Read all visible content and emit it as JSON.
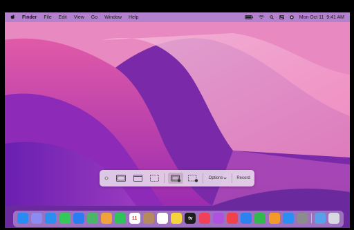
{
  "menubar": {
    "apple": "",
    "app_name": "Finder",
    "items": [
      "File",
      "Edit",
      "View",
      "Go",
      "Window",
      "Help"
    ],
    "datetime": "Mon Oct 11  9:41 AM"
  },
  "screenshot_toolbar": {
    "options_label": "Options",
    "record_label": "Record"
  },
  "dock": {
    "items": [
      {
        "name": "finder",
        "color": "#2a8bf2"
      },
      {
        "name": "launchpad",
        "color": "#8c8cf0"
      },
      {
        "name": "safari",
        "color": "#2b8ef0"
      },
      {
        "name": "messages",
        "color": "#35c759"
      },
      {
        "name": "mail",
        "color": "#2a7cf2"
      },
      {
        "name": "maps",
        "color": "#4cb56a"
      },
      {
        "name": "photos",
        "color": "#f2a23a"
      },
      {
        "name": "facetime",
        "color": "#30c25a"
      },
      {
        "name": "calendar",
        "color": "#ffffff",
        "text": "11"
      },
      {
        "name": "contacts",
        "color": "#b58a5e"
      },
      {
        "name": "reminders",
        "color": "#ffffff"
      },
      {
        "name": "notes",
        "color": "#f5d33c"
      },
      {
        "name": "tv",
        "color": "#1d1d1d",
        "text": "tv"
      },
      {
        "name": "music",
        "color": "#f0405a"
      },
      {
        "name": "podcasts",
        "color": "#b052e0"
      },
      {
        "name": "news",
        "color": "#f0424a"
      },
      {
        "name": "keynote",
        "color": "#2d82f0"
      },
      {
        "name": "numbers",
        "color": "#33b84e"
      },
      {
        "name": "pages",
        "color": "#f29a2a"
      },
      {
        "name": "app-store",
        "color": "#2a8ef2"
      },
      {
        "name": "system-preferences",
        "color": "#8c8c8c"
      },
      {
        "name": "downloads-folder",
        "color": "#5aa0e8"
      },
      {
        "name": "trash",
        "color": "#d8d8e0"
      }
    ]
  }
}
